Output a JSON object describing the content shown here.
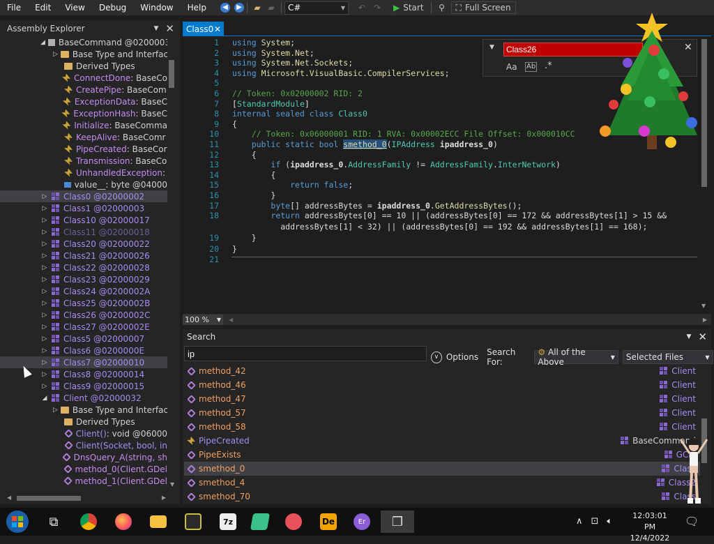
{
  "menu": [
    "File",
    "Edit",
    "View",
    "Debug",
    "Window",
    "Help"
  ],
  "toolbar": {
    "lang": "C#",
    "start": "Start",
    "fullscreen": "Full Screen"
  },
  "explorer": {
    "title": "Assembly Explorer",
    "rows": [
      {
        "arrow": "◢",
        "icon": "base",
        "text": "BaseCommand @0200003",
        "cls": "t-gray",
        "indent": 70
      },
      {
        "arrow": "▷",
        "icon": "folder",
        "text": "Base Type and Interfac",
        "cls": "t-gray",
        "indent": 88
      },
      {
        "arrow": "",
        "icon": "folder",
        "text": "Derived Types",
        "cls": "t-gray",
        "indent": 88
      },
      {
        "arrow": "",
        "icon": "ev",
        "text": "ConnectDone",
        "suffix": " : BaseCo",
        "cls": "t-ev",
        "indent": 88
      },
      {
        "arrow": "",
        "icon": "ev",
        "text": "CreatePipe",
        "suffix": " : BaseCom",
        "cls": "t-ev",
        "indent": 88
      },
      {
        "arrow": "",
        "icon": "ev",
        "text": "ExceptionData",
        "suffix": " : BaseC",
        "cls": "t-ev",
        "indent": 88
      },
      {
        "arrow": "",
        "icon": "ev",
        "text": "ExceptionHash",
        "suffix": " : BaseC",
        "cls": "t-ev",
        "indent": 88
      },
      {
        "arrow": "",
        "icon": "ev",
        "text": "Initialize",
        "suffix": " : BaseComma",
        "cls": "t-ev",
        "indent": 88
      },
      {
        "arrow": "",
        "icon": "ev",
        "text": "KeepAlive",
        "suffix": " : BaseComr",
        "cls": "t-ev",
        "indent": 88
      },
      {
        "arrow": "",
        "icon": "ev",
        "text": "PipeCreated",
        "suffix": " : BaseCor",
        "cls": "t-ev",
        "indent": 88
      },
      {
        "arrow": "",
        "icon": "ev",
        "text": "Transmission",
        "suffix": " : BaseCo",
        "cls": "t-ev",
        "indent": 88
      },
      {
        "arrow": "",
        "icon": "ev",
        "text": "UnhandledException",
        "suffix": " :",
        "cls": "t-ev",
        "indent": 88
      },
      {
        "arrow": "",
        "icon": "fld",
        "text": "value__",
        "suffix": " : byte @04000",
        "cls": "t-gray",
        "indent": 88
      },
      {
        "arrow": "▷",
        "icon": "cls",
        "text": "Class0 @02000002",
        "cls": "t-link",
        "indent": 70,
        "sel": true
      },
      {
        "arrow": "▷",
        "icon": "cls",
        "text": "Class1 @02000003",
        "cls": "t-link",
        "indent": 70
      },
      {
        "arrow": "▷",
        "icon": "cls",
        "text": "Class10 @02000017",
        "cls": "t-link",
        "indent": 70
      },
      {
        "arrow": "▷",
        "icon": "cls",
        "text": "Class11 @02000018",
        "cls": "t-link",
        "indent": 70,
        "dim": true
      },
      {
        "arrow": "▷",
        "icon": "cls",
        "text": "Class20 @02000022",
        "cls": "t-link",
        "indent": 70
      },
      {
        "arrow": "▷",
        "icon": "cls",
        "text": "Class21 @02000026",
        "cls": "t-link",
        "indent": 70
      },
      {
        "arrow": "▷",
        "icon": "cls",
        "text": "Class22 @02000028",
        "cls": "t-link",
        "indent": 70
      },
      {
        "arrow": "▷",
        "icon": "cls",
        "text": "Class23 @02000029",
        "cls": "t-link",
        "indent": 70
      },
      {
        "arrow": "▷",
        "icon": "cls",
        "text": "Class24 @0200002A",
        "cls": "t-link",
        "indent": 70
      },
      {
        "arrow": "▷",
        "icon": "cls",
        "text": "Class25 @0200002B",
        "cls": "t-link",
        "indent": 70
      },
      {
        "arrow": "▷",
        "icon": "cls",
        "text": "Class26 @0200002C",
        "cls": "t-link",
        "indent": 70
      },
      {
        "arrow": "▷",
        "icon": "cls",
        "text": "Class27 @0200002E",
        "cls": "t-link",
        "indent": 70
      },
      {
        "arrow": "▷",
        "icon": "cls",
        "text": "Class5 @02000007",
        "cls": "t-link",
        "indent": 70
      },
      {
        "arrow": "▷",
        "icon": "cls",
        "text": "Class6 @0200000E",
        "cls": "t-link",
        "indent": 70
      },
      {
        "arrow": "▷",
        "icon": "cls",
        "text": "Class7 @02000010",
        "cls": "t-link",
        "indent": 70,
        "sel": true
      },
      {
        "arrow": "▷",
        "icon": "cls",
        "text": "Class8 @02000014",
        "cls": "t-link",
        "indent": 70
      },
      {
        "arrow": "▷",
        "icon": "cls",
        "text": "Class9 @02000015",
        "cls": "t-link",
        "indent": 70
      },
      {
        "arrow": "◢",
        "icon": "cls",
        "text": "Client @02000032",
        "cls": "t-link",
        "indent": 70
      },
      {
        "arrow": "▷",
        "icon": "folder",
        "text": "Base Type and Interfac",
        "cls": "t-gray",
        "indent": 88
      },
      {
        "arrow": "",
        "icon": "folder",
        "text": "Derived Types",
        "cls": "t-gray",
        "indent": 88
      },
      {
        "arrow": "",
        "icon": "meth",
        "text": "Client()",
        "suffix": " : void @06000",
        "cls": "t-link",
        "indent": 88
      },
      {
        "arrow": "",
        "icon": "meth",
        "text": "Client(Socket, bool, in",
        "cls": "t-link",
        "indent": 88
      },
      {
        "arrow": "",
        "icon": "meth",
        "text": "DnsQuery_A(string, sh",
        "cls": "t-ev",
        "indent": 88
      },
      {
        "arrow": "",
        "icon": "meth",
        "text": "method_0(Client.GDel",
        "cls": "t-ev",
        "indent": 88
      },
      {
        "arrow": "",
        "icon": "meth",
        "text": "method_1(Client.GDel",
        "cls": "t-ev",
        "indent": 88
      }
    ]
  },
  "tab": {
    "label": "Class0"
  },
  "editor": {
    "lines": [
      {
        "n": "1",
        "html": "<span class='kw'>using</span> <span class='ns'>System</span>;"
      },
      {
        "n": "2",
        "html": "<span class='kw'>using</span> <span class='ns'>System.Net</span>;"
      },
      {
        "n": "3",
        "html": "<span class='kw'>using</span> <span class='ns'>System.Net.Sockets</span>;"
      },
      {
        "n": "4",
        "html": "<span class='kw'>using</span> <span class='ns'>Microsoft.VisualBasic.CompilerServices</span>;"
      },
      {
        "n": "5",
        "html": ""
      },
      {
        "n": "6",
        "html": "<span class='cm'>// Token: 0x02000002 RID: 2</span>"
      },
      {
        "n": "7",
        "html": "[<span class='ty'>StandardModule</span>]"
      },
      {
        "n": "8",
        "html": "<span class='kw'>internal sealed class</span> <span class='ty'>Class0</span>"
      },
      {
        "n": "9",
        "html": "{"
      },
      {
        "n": "10",
        "html": "    <span class='cm'>// Token: 0x06000001 RID: 1 RVA: 0x00002ECC File Offset: 0x000010CC</span>"
      },
      {
        "n": "11",
        "html": "    <span class='kw'>public static bool</span> <span class='mt' style='background:#264f78;text-decoration:underline'>smethod_0</span>(<span class='ty'>IPAddress</span> <span class='bold'>ipaddress_0</span>)"
      },
      {
        "n": "12",
        "html": "    {"
      },
      {
        "n": "13",
        "html": "        <span class='kw'>if</span> (<span class='bold'>ipaddress_0</span>.<span class='ty'>AddressFamily</span> != <span class='ty'>AddressFamily</span>.<span class='ty'>InterNetwork</span>)"
      },
      {
        "n": "14",
        "html": "        {"
      },
      {
        "n": "15",
        "html": "            <span class='kw'>return false</span>;"
      },
      {
        "n": "16",
        "html": "        }"
      },
      {
        "n": "17",
        "html": "        <span class='kw'>byte</span>[] addressBytes = <span class='bold'>ipaddress_0</span>.<span class='mt'>GetAddressBytes</span>();"
      },
      {
        "n": "18",
        "html": "        <span class='kw'>return</span> addressBytes[0] == 10 || (addressBytes[0] == 172 &amp;&amp; addressBytes[1] &gt; 15 &amp;&amp;"
      },
      {
        "n": "",
        "html": "          addressBytes[1] &lt; 32) || (addressBytes[0] == 192 &amp;&amp; addressBytes[1] == 168);"
      },
      {
        "n": "19",
        "html": "    }"
      },
      {
        "n": "20",
        "html": "}"
      },
      {
        "n": "21",
        "html": ""
      }
    ]
  },
  "find": {
    "value": "Class26",
    "aa": "Aa",
    "ab": "Ab",
    "regex": ".*"
  },
  "zoom": {
    "value": "100 %"
  },
  "search": {
    "title": "Search",
    "query": "ip",
    "options": "Options",
    "search_for": "Search For:",
    "filter": "All of the Above",
    "scope": "Selected Files",
    "results": [
      {
        "name": "method_42",
        "right": "Client"
      },
      {
        "name": "method_46",
        "right": "Client"
      },
      {
        "name": "method_47",
        "right": "Client"
      },
      {
        "name": "method_57",
        "right": "Client"
      },
      {
        "name": "method_58",
        "right": "Client"
      },
      {
        "name": "PipeCreated",
        "right": "BaseCommand",
        "kind": "ev"
      },
      {
        "name": "PipeExists",
        "right": "GCla",
        "kind": "prop"
      },
      {
        "name": "smethod_0",
        "right": "Class",
        "sel": true
      },
      {
        "name": "smethod_4",
        "right": "Class2"
      },
      {
        "name": "smethod_70",
        "right": "Class"
      }
    ]
  },
  "taskbar": {
    "time": "12:03:01 PM",
    "date": "12/4/2022"
  }
}
